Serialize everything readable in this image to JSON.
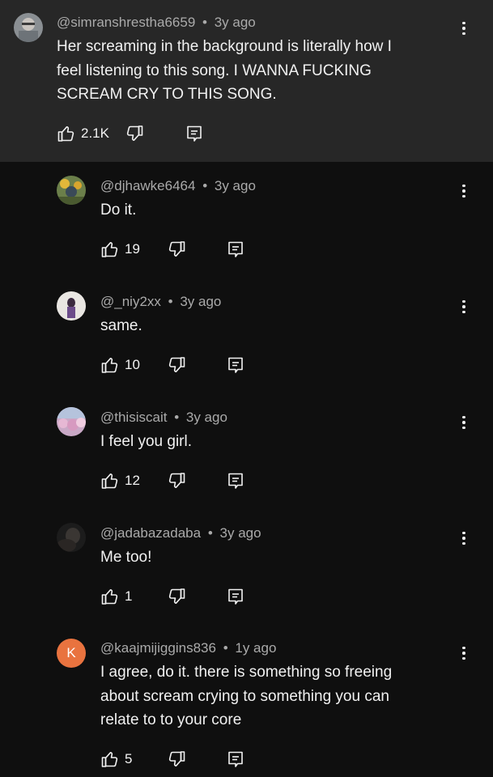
{
  "top_comment": {
    "author": "@simranshrestha6659",
    "time": "3y ago",
    "lines": [
      "Her screaming in the background is literally how I",
      "feel listening to this song. I WANNA FUCKING",
      "SCREAM CRY TO THIS SONG."
    ],
    "likes": "2.1K"
  },
  "replies": [
    {
      "author": "@djhawke6464",
      "time": "3y ago",
      "lines": [
        "Do it."
      ],
      "likes": "19"
    },
    {
      "author": "@_niy2xx",
      "time": "3y ago",
      "lines": [
        "same."
      ],
      "likes": "10"
    },
    {
      "author": "@thisiscait",
      "time": "3y ago",
      "lines": [
        "I feel you girl."
      ],
      "likes": "12"
    },
    {
      "author": "@jadabazadaba",
      "time": "3y ago",
      "lines": [
        "Me too!"
      ],
      "likes": "1"
    },
    {
      "author": "@kaajmijiggins836",
      "time": "1y ago",
      "avatar_letter": "K",
      "lines": [
        "I agree, do it. there is something so freeing",
        "about scream crying to something you can",
        "relate to to your core"
      ],
      "likes": "5"
    }
  ],
  "separator": "•",
  "icons": {
    "like": "thumbs-up-icon",
    "dislike": "thumbs-down-icon",
    "reply": "reply-comment-icon",
    "more": "more-vertical-icon"
  },
  "colors": {
    "background": "#0f0f0f",
    "highlight": "#272727",
    "text": "#f1f1f1",
    "meta": "#aaaaaa",
    "letter_avatar": "#e9733f"
  }
}
